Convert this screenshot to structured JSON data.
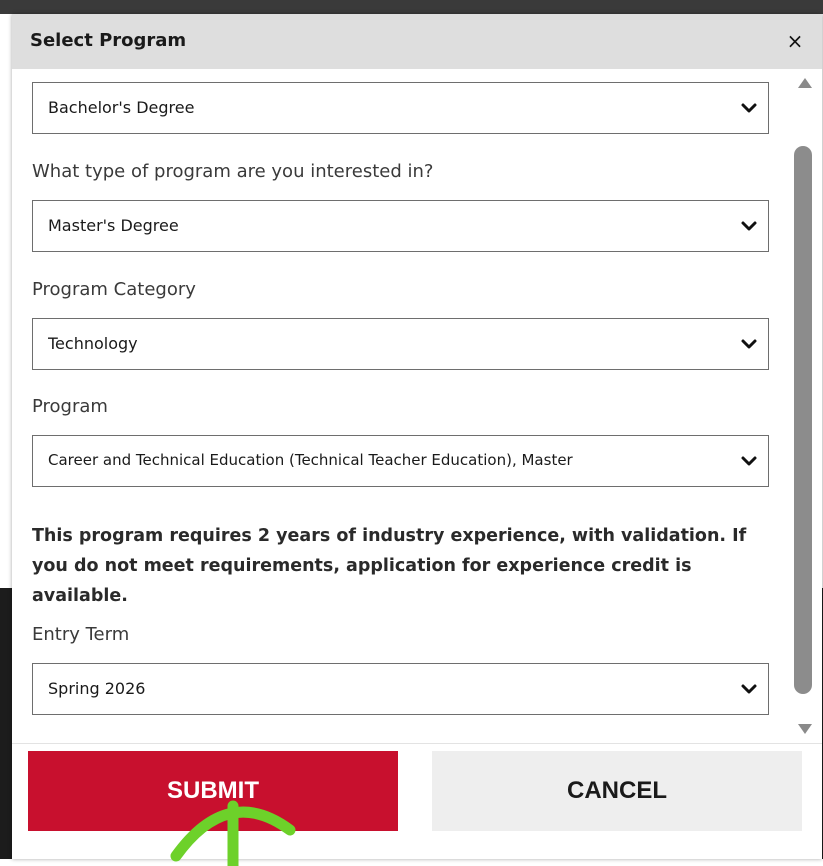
{
  "modal": {
    "title": "Select Program",
    "close_label": "×",
    "icons": {
      "close": "close-icon",
      "dropdown": "chevron-down-icon"
    }
  },
  "fields": {
    "degree_select_value": "Bachelor's Degree",
    "program_type_label": "What type of program are you interested in?",
    "program_type_value": "Master's Degree",
    "category_label": "Program Category",
    "category_value": "Technology",
    "program_label": "Program",
    "program_value": "Career and Technical Education (Technical Teacher Education), Master",
    "program_note": "This program requires 2 years of industry experience, with validation. If you do not meet requirements, application for experience credit is available.",
    "entry_term_label": "Entry Term",
    "entry_term_value": "Spring 2026"
  },
  "actions": {
    "submit_label": "SUBMIT",
    "cancel_label": "CANCEL"
  },
  "colors": {
    "submit_bg": "#c8102e",
    "cancel_bg": "#eeeeee",
    "header_bg": "#dedede",
    "annotation_arrow": "#6dd12a"
  }
}
